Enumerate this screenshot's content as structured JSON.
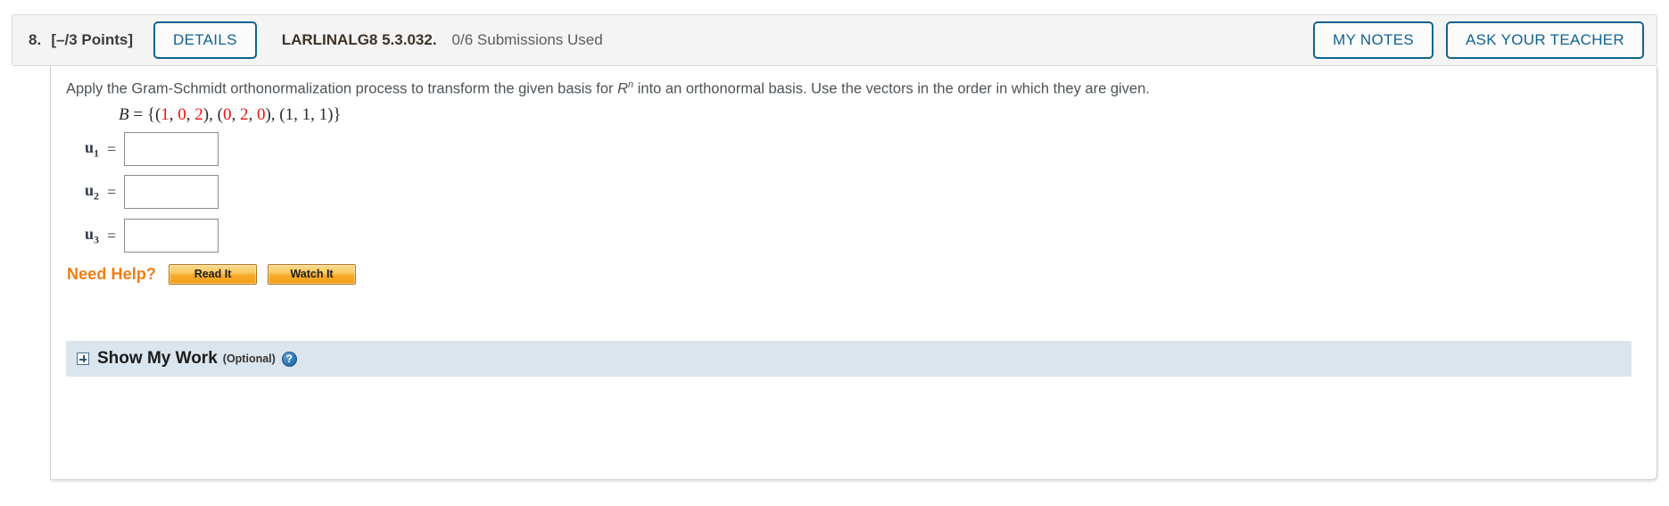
{
  "header": {
    "question_number": "8.",
    "points": "[–/3 Points]",
    "details_label": "DETAILS",
    "textbook_ref": "LARLINALG8 5.3.032.",
    "submissions": "0/6 Submissions Used",
    "my_notes_label": "MY NOTES",
    "ask_teacher_label": "ASK YOUR TEACHER"
  },
  "problem": {
    "prompt_part1": "Apply the Gram-Schmidt orthonormalization process to transform the given basis for ",
    "prompt_var": "R",
    "prompt_exp": "n",
    "prompt_part2": " into an orthonormal basis. Use the vectors in the order in which they are given.",
    "basis": {
      "name": "B",
      "equals": "=",
      "open": "{(",
      "vectors": [
        {
          "values": [
            "1",
            "0",
            "2"
          ],
          "color": "#ee1111"
        },
        {
          "values": [
            "0",
            "2",
            "0"
          ],
          "color": "#ee1111"
        },
        {
          "values": [
            "1",
            "1",
            "1"
          ],
          "color": "#2b2b2b"
        }
      ],
      "close": ")}"
    }
  },
  "answers": [
    {
      "label": "u",
      "sub": "1",
      "equals": "=",
      "value": "",
      "placeholder": ""
    },
    {
      "label": "u",
      "sub": "2",
      "equals": "=",
      "value": "",
      "placeholder": ""
    },
    {
      "label": "u",
      "sub": "3",
      "equals": "=",
      "value": "",
      "placeholder": ""
    }
  ],
  "need_help": {
    "label": "Need Help?",
    "buttons": [
      {
        "label": "Read It"
      },
      {
        "label": "Watch It"
      }
    ]
  },
  "show_my_work": {
    "expand_icon": "plus-box-icon",
    "title": "Show My Work",
    "optional": "(Optional)",
    "help_icon_glyph": "?"
  },
  "colors": {
    "accent_blue": "#11638f",
    "orange": "#f07e13",
    "red": "#ee1111",
    "bar_blue": "#dbe5ed",
    "header_bg": "#f4f4f4"
  }
}
